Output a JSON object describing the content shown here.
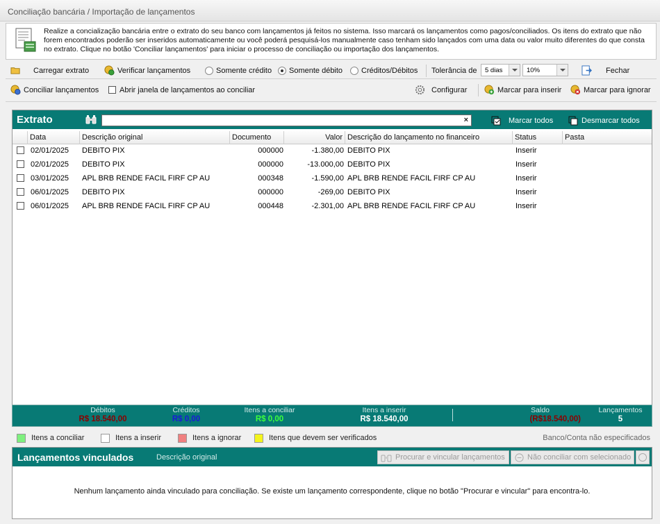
{
  "window": {
    "title": "Conciliação bancária / Importação de lançamentos"
  },
  "info": {
    "text": "Realize a concialização bancária entre o extrato do seu banco com lançamentos já feitos no sistema. Isso marcará os lançamentos como pagos/conciliados. Os itens do extrato que não forem encontrados poderão ser inseridos automaticamente ou você poderá pesquisá-los manualmente caso tenham sido lançados com uma data ou valor muito diferentes do que consta no extrato. Clique no botão 'Conciliar lançamentos' para iniciar o processo de conciliação ou importação dos lançamentos."
  },
  "toolbar1": {
    "carregar": "Carregar extrato",
    "verificar": "Verificar lançamentos",
    "radios": [
      {
        "label": "Somente crédito",
        "selected": false
      },
      {
        "label": "Somente débito",
        "selected": true
      },
      {
        "label": "Créditos/Débitos",
        "selected": false
      }
    ],
    "tolerancia_label": "Tolerância de",
    "tolerancia_dias": "5 dias",
    "tolerancia_pct": "10%",
    "fechar": "Fechar"
  },
  "toolbar2": {
    "conciliar": "Conciliar lançamentos",
    "abrir_janela": "Abrir janela de lançamentos ao conciliar",
    "configurar": "Configurar",
    "marcar_inserir": "Marcar para inserir",
    "marcar_ignorar": "Marcar para ignorar"
  },
  "extrato": {
    "title": "Extrato",
    "marcar_todos": "Marcar todos",
    "desmarcar_todos": "Desmarcar todos",
    "columns": [
      "Data",
      "Descrição original",
      "Documento",
      "Valor",
      "Descrição do lançamento no financeiro",
      "Status",
      "Pasta"
    ],
    "rows": [
      {
        "data": "02/01/2025",
        "descricao": "DEBITO PIX",
        "documento": "000000",
        "valor": "-1.380,00",
        "desc_fin": "DEBITO PIX",
        "status": "Inserir",
        "pasta": ""
      },
      {
        "data": "02/01/2025",
        "descricao": "DEBITO PIX",
        "documento": "000000",
        "valor": "-13.000,00",
        "desc_fin": "DEBITO PIX",
        "status": "Inserir",
        "pasta": ""
      },
      {
        "data": "03/01/2025",
        "descricao": "APL BRB RENDE FACIL FIRF CP AU",
        "documento": "000348",
        "valor": "-1.590,00",
        "desc_fin": "APL BRB RENDE FACIL FIRF CP AU",
        "status": "Inserir",
        "pasta": ""
      },
      {
        "data": "06/01/2025",
        "descricao": "DEBITO PIX",
        "documento": "000000",
        "valor": "-269,00",
        "desc_fin": "DEBITO PIX",
        "status": "Inserir",
        "pasta": ""
      },
      {
        "data": "06/01/2025",
        "descricao": "APL BRB RENDE FACIL FIRF CP AU",
        "documento": "000448",
        "valor": "-2.301,00",
        "desc_fin": "APL BRB RENDE FACIL FIRF CP AU",
        "status": "Inserir",
        "pasta": ""
      }
    ]
  },
  "totals": {
    "debitos": {
      "label": "Débitos",
      "value": "R$ 18.540,00",
      "color": "#8b0000"
    },
    "creditos": {
      "label": "Créditos",
      "value": "R$ 0,00",
      "color": "#1a1ad6"
    },
    "conciliar": {
      "label": "Itens a conciliar",
      "value": "R$ 0,00",
      "color": "#3cff3c"
    },
    "inserir": {
      "label": "Itens a inserir",
      "value": "R$ 18.540,00",
      "color": "#ffffff"
    },
    "saldo": {
      "label": "Saldo",
      "value": "(R$18.540,00)",
      "color": "#8b0000"
    },
    "lancamentos": {
      "label": "Lançamentos",
      "value": "5",
      "color": "#ffffff"
    }
  },
  "legend": [
    {
      "label": "Itens a conciliar",
      "color": "#7ef07e"
    },
    {
      "label": "Itens a inserir",
      "color": "#ffffff"
    },
    {
      "label": "Itens a ignorar",
      "color": "#f08080"
    },
    {
      "label": "Itens que devem ser verificados",
      "color": "#f4f41c"
    }
  ],
  "banco_conta": "Banco/Conta não especificados",
  "vinculados": {
    "title": "Lançamentos vinculados",
    "subtitle": "Descrição original",
    "procurar": "Procurar e vincular lançamentos",
    "nao_conciliar": "Não conciliar com selecionado",
    "empty_msg": "Nenhum lançamento ainda vinculado para conciliação. Se existe um lançamento correspondente, clique no botão \"Procurar e vincular\" para encontra-lo."
  }
}
